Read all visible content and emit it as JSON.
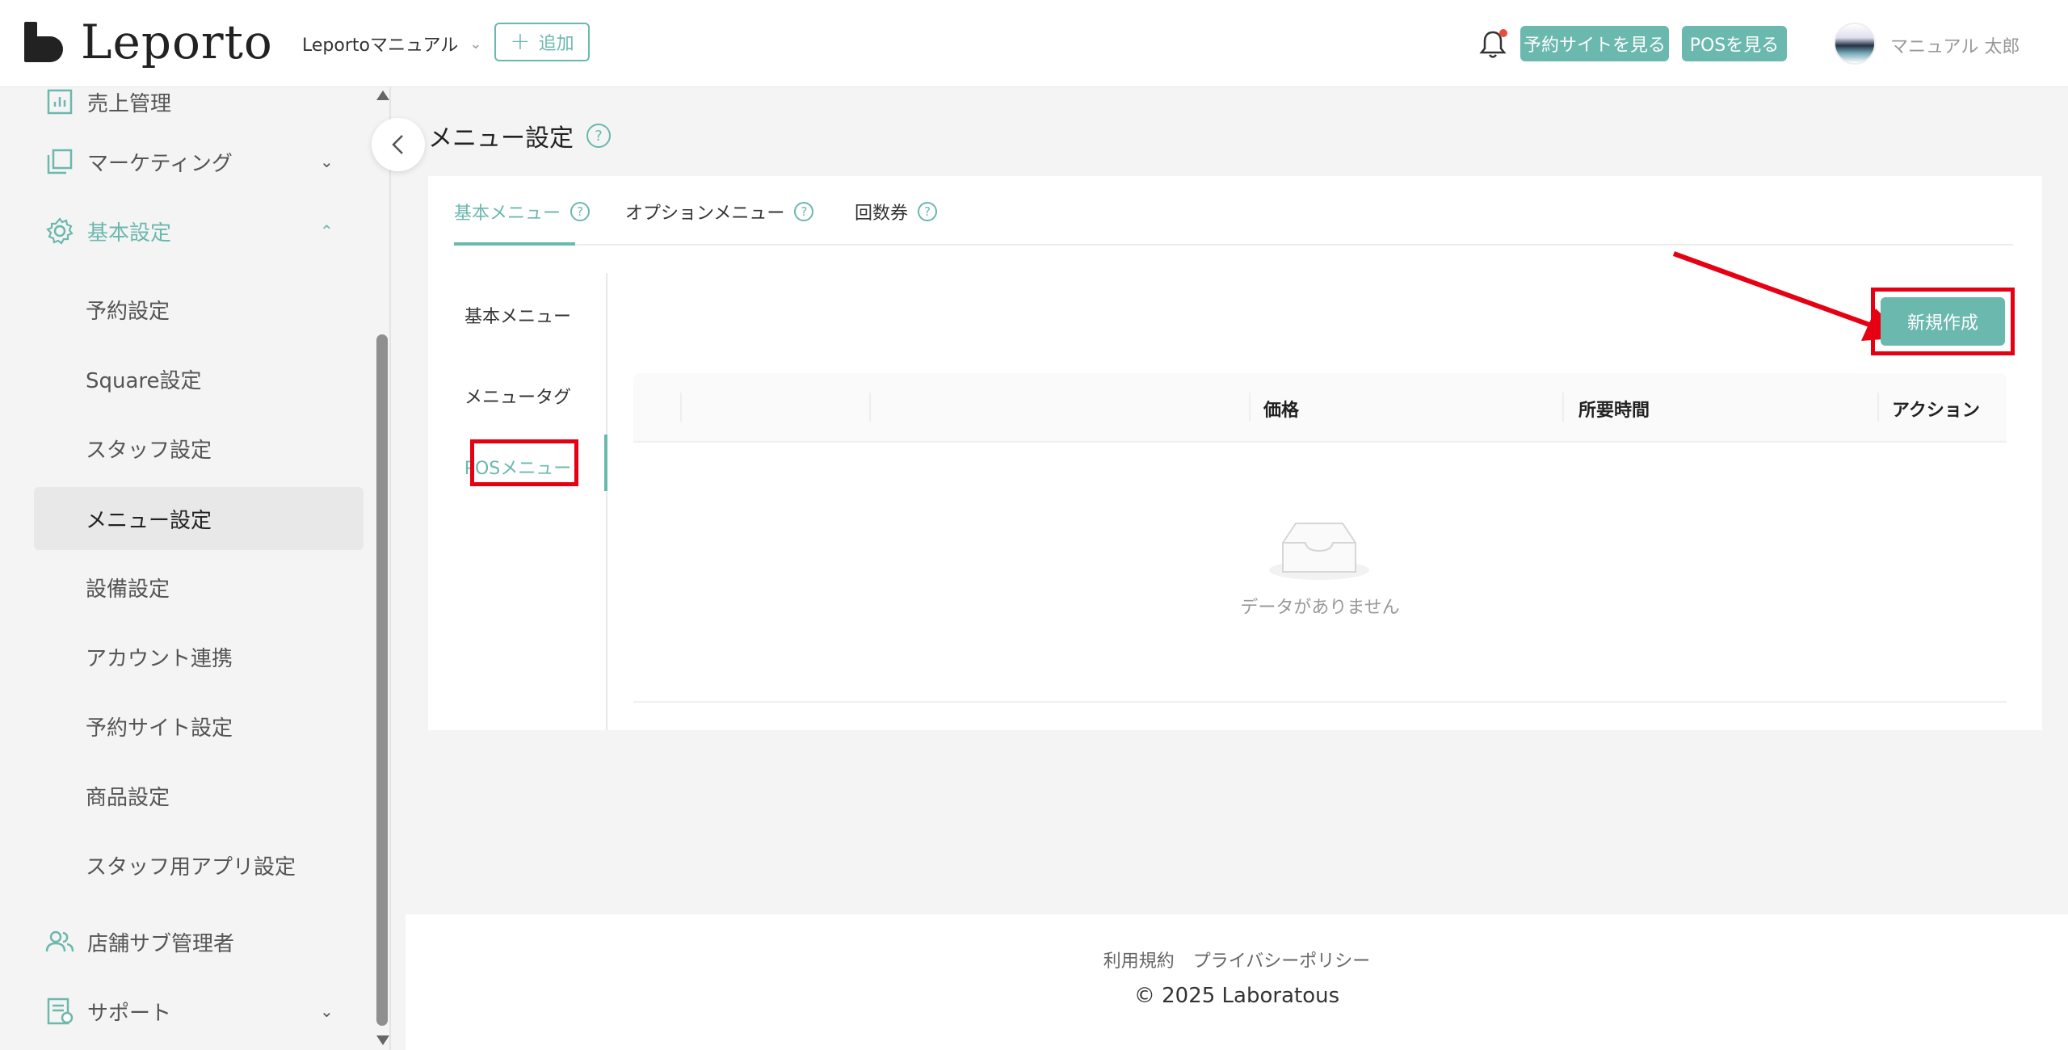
{
  "header": {
    "logo_text": "Leporto",
    "store_name": "Leportoマニュアル",
    "add_label": "追加",
    "site_button": "予約サイトを見る",
    "pos_button": "POSを見る",
    "user_name": "マニュアル 太郎"
  },
  "sidebar": {
    "items": [
      {
        "label": "売上管理",
        "icon": "chart-icon"
      },
      {
        "label": "マーケティング",
        "icon": "copy-icon"
      },
      {
        "label": "基本設定",
        "icon": "gear-icon"
      },
      {
        "label": "店舗サブ管理者",
        "icon": "users-icon"
      },
      {
        "label": "サポート",
        "icon": "doc-icon"
      }
    ],
    "sub_items": [
      "予約設定",
      "Square設定",
      "スタッフ設定",
      "メニュー設定",
      "設備設定",
      "アカウント連携",
      "予約サイト設定",
      "商品設定",
      "スタッフ用アプリ設定"
    ]
  },
  "page": {
    "title": "メニュー設定",
    "tabs": [
      "基本メニュー",
      "オプションメニュー",
      "回数券"
    ],
    "subnav": [
      "基本メニュー",
      "メニュータグ",
      "POSメニュー"
    ],
    "new_button": "新規作成",
    "columns": [
      "価格",
      "所要時間",
      "アクション"
    ],
    "empty_text": "データがありません"
  },
  "footer": {
    "terms": "利用規約",
    "privacy": "プライバシーポリシー",
    "copyright": "2025 Laboratous"
  },
  "colors": {
    "accent": "#6bb8ae",
    "annotation": "#e60012"
  }
}
